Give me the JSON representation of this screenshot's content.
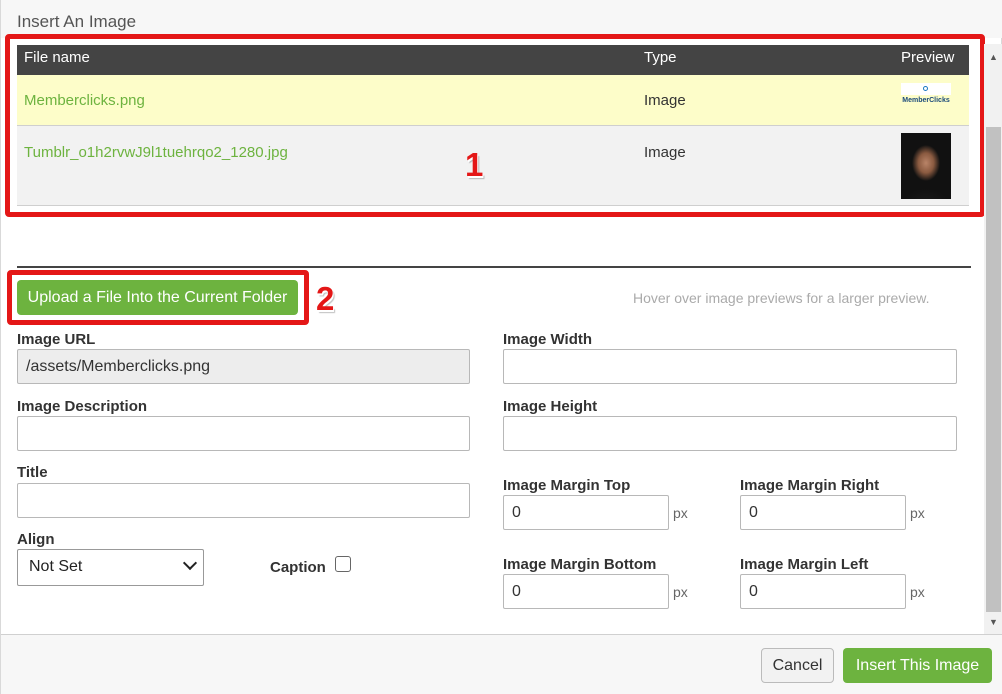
{
  "dialog": {
    "title": "Insert An Image"
  },
  "file_table": {
    "headers": [
      "File name",
      "Type",
      "Preview"
    ],
    "rows": [
      {
        "file_name": "Memberclicks.png",
        "type": "Image",
        "preview": "memberclicks-logo-thumbnail",
        "preview_text": "MemberClicks"
      },
      {
        "file_name": "Tumblr_o1h2rvwJ9l1tuehrqo2_1280.jpg",
        "type": "Image",
        "preview": "portrait-photo-thumbnail"
      }
    ]
  },
  "annotations": {
    "one": "1",
    "two": "2",
    "color": "#e41717"
  },
  "upload": {
    "label": "Upload a File Into the Current Folder",
    "hint": "Hover over image previews for a larger preview."
  },
  "form": {
    "image_url_label": "Image URL",
    "image_url_value": "/assets/Memberclicks.png",
    "image_description_label": "Image Description",
    "image_description_value": "",
    "title_label": "Title",
    "title_value": "",
    "align_label": "Align",
    "align_value": "Not Set",
    "caption_label": "Caption",
    "caption_checked": false,
    "image_width_label": "Image Width",
    "image_width_value": "",
    "image_height_label": "Image Height",
    "image_height_value": "",
    "margin_top_label": "Image Margin Top",
    "margin_top_value": "0",
    "margin_right_label": "Image Margin Right",
    "margin_right_value": "0",
    "margin_bottom_label": "Image Margin Bottom",
    "margin_bottom_value": "0",
    "margin_left_label": "Image Margin Left",
    "margin_left_value": "0",
    "unit": "px"
  },
  "footer": {
    "cancel_label": "Cancel",
    "insert_label": "Insert This Image"
  },
  "colors": {
    "accent_green": "#6db33f",
    "table_header": "#444444",
    "selected_row": "#fdfdc9"
  }
}
